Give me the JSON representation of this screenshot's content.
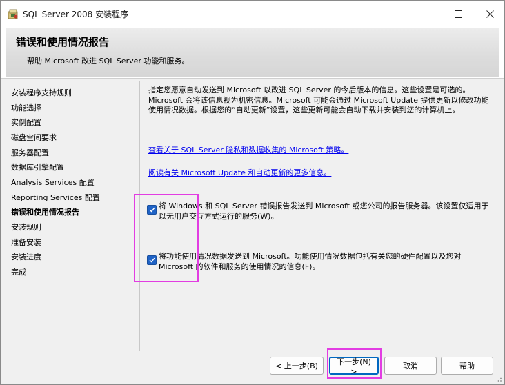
{
  "window": {
    "title": "SQL Server 2008 安装程序",
    "icon": "sql-server-setup-icon",
    "controls": {
      "minimize": "minimize-icon",
      "maximize": "maximize-icon",
      "close": "close-icon"
    }
  },
  "header": {
    "title": "错误和使用情况报告",
    "subtitle": "帮助 Microsoft 改进 SQL Server 功能和服务。"
  },
  "nav": {
    "items": [
      {
        "label": "安装程序支持规则"
      },
      {
        "label": "功能选择"
      },
      {
        "label": "实例配置"
      },
      {
        "label": "磁盘空间要求"
      },
      {
        "label": "服务器配置"
      },
      {
        "label": "数据库引擎配置"
      },
      {
        "label": "Analysis Services 配置"
      },
      {
        "label": "Reporting Services 配置"
      },
      {
        "label": "错误和使用情况报告",
        "active": true
      },
      {
        "label": "安装规则"
      },
      {
        "label": "准备安装"
      },
      {
        "label": "安装进度"
      },
      {
        "label": "完成"
      }
    ]
  },
  "content": {
    "intro_lines": [
      "指定您愿意自动发送到 Microsoft 以改进 SQL Server 的今后版本的信息。这些设置是可选的。",
      "Microsoft 会将该信息视为机密信息。Microsoft 可能会通过 Microsoft Update 提供更新以修改功能",
      "使用情况数据。根据您的“自动更新”设置，这些更新可能会自动下载并安装到您的计算机上。"
    ],
    "link_privacy": "查看关于 SQL Server 隐私和数据收集的 Microsoft 策略。",
    "link_update": "阅读有关 Microsoft Update 和自动更新的更多信息。",
    "checkbox_error": {
      "checked": true,
      "lines": [
        "将 Windows 和 SQL Server 错误报告发送到 Microsoft 或您公司的报告服务器。该设置仅适用于",
        "以无用户交互方式运行的服务(W)。"
      ]
    },
    "checkbox_usage": {
      "checked": true,
      "lines": [
        "将功能使用情况数据发送到 Microsoft。功能使用情况数据包括有关您的硬件配置以及您对",
        "Microsoft 的软件和服务的使用情况的信息(F)。"
      ]
    }
  },
  "buttons": {
    "prev": "< 上一步(B)",
    "next": "下一步(N) >",
    "cancel": "取消",
    "help": "帮助"
  },
  "colors": {
    "checkbox_fill": "#1f63c7",
    "link": "#0000ee",
    "highlight": "#e23de2"
  }
}
